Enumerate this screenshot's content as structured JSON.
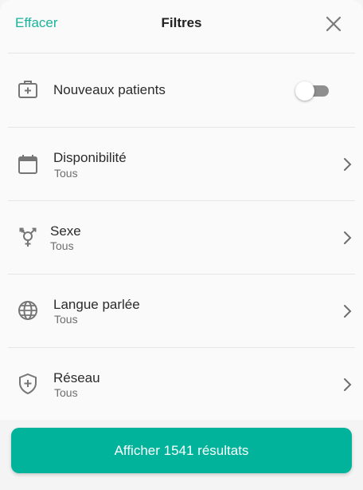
{
  "header": {
    "clear_label": "Effacer",
    "title": "Filtres",
    "close_icon": "close-icon"
  },
  "filters": {
    "new_patients": {
      "label": "Nouveaux patients",
      "icon": "medical-kit-icon",
      "enabled": false
    },
    "availability": {
      "label": "Disponibilité",
      "value": "Tous",
      "icon": "calendar-icon"
    },
    "sex": {
      "label": "Sexe",
      "value": "Tous",
      "icon": "gender-icon"
    },
    "language": {
      "label": "Langue parlée",
      "value": "Tous",
      "icon": "globe-icon"
    },
    "network": {
      "label": "Réseau",
      "value": "Tous",
      "icon": "shield-plus-icon"
    }
  },
  "footer": {
    "cta_label": "Afficher 1541 résultats"
  },
  "colors": {
    "accent": "#00b39a",
    "accent_text": "#1bb49b",
    "icon_gray": "#767676"
  }
}
